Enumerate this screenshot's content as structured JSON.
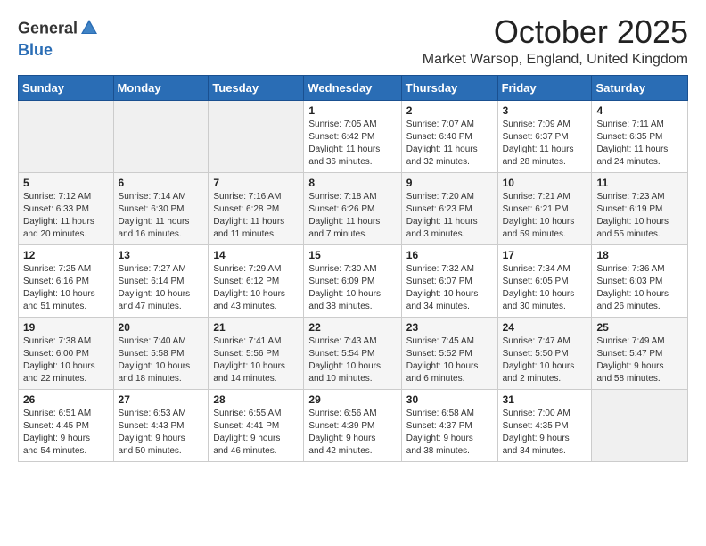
{
  "logo": {
    "general": "General",
    "blue": "Blue"
  },
  "title": "October 2025",
  "subtitle": "Market Warsop, England, United Kingdom",
  "days_of_week": [
    "Sunday",
    "Monday",
    "Tuesday",
    "Wednesday",
    "Thursday",
    "Friday",
    "Saturday"
  ],
  "weeks": [
    [
      {
        "day": "",
        "info": ""
      },
      {
        "day": "",
        "info": ""
      },
      {
        "day": "",
        "info": ""
      },
      {
        "day": "1",
        "info": "Sunrise: 7:05 AM\nSunset: 6:42 PM\nDaylight: 11 hours\nand 36 minutes."
      },
      {
        "day": "2",
        "info": "Sunrise: 7:07 AM\nSunset: 6:40 PM\nDaylight: 11 hours\nand 32 minutes."
      },
      {
        "day": "3",
        "info": "Sunrise: 7:09 AM\nSunset: 6:37 PM\nDaylight: 11 hours\nand 28 minutes."
      },
      {
        "day": "4",
        "info": "Sunrise: 7:11 AM\nSunset: 6:35 PM\nDaylight: 11 hours\nand 24 minutes."
      }
    ],
    [
      {
        "day": "5",
        "info": "Sunrise: 7:12 AM\nSunset: 6:33 PM\nDaylight: 11 hours\nand 20 minutes."
      },
      {
        "day": "6",
        "info": "Sunrise: 7:14 AM\nSunset: 6:30 PM\nDaylight: 11 hours\nand 16 minutes."
      },
      {
        "day": "7",
        "info": "Sunrise: 7:16 AM\nSunset: 6:28 PM\nDaylight: 11 hours\nand 11 minutes."
      },
      {
        "day": "8",
        "info": "Sunrise: 7:18 AM\nSunset: 6:26 PM\nDaylight: 11 hours\nand 7 minutes."
      },
      {
        "day": "9",
        "info": "Sunrise: 7:20 AM\nSunset: 6:23 PM\nDaylight: 11 hours\nand 3 minutes."
      },
      {
        "day": "10",
        "info": "Sunrise: 7:21 AM\nSunset: 6:21 PM\nDaylight: 10 hours\nand 59 minutes."
      },
      {
        "day": "11",
        "info": "Sunrise: 7:23 AM\nSunset: 6:19 PM\nDaylight: 10 hours\nand 55 minutes."
      }
    ],
    [
      {
        "day": "12",
        "info": "Sunrise: 7:25 AM\nSunset: 6:16 PM\nDaylight: 10 hours\nand 51 minutes."
      },
      {
        "day": "13",
        "info": "Sunrise: 7:27 AM\nSunset: 6:14 PM\nDaylight: 10 hours\nand 47 minutes."
      },
      {
        "day": "14",
        "info": "Sunrise: 7:29 AM\nSunset: 6:12 PM\nDaylight: 10 hours\nand 43 minutes."
      },
      {
        "day": "15",
        "info": "Sunrise: 7:30 AM\nSunset: 6:09 PM\nDaylight: 10 hours\nand 38 minutes."
      },
      {
        "day": "16",
        "info": "Sunrise: 7:32 AM\nSunset: 6:07 PM\nDaylight: 10 hours\nand 34 minutes."
      },
      {
        "day": "17",
        "info": "Sunrise: 7:34 AM\nSunset: 6:05 PM\nDaylight: 10 hours\nand 30 minutes."
      },
      {
        "day": "18",
        "info": "Sunrise: 7:36 AM\nSunset: 6:03 PM\nDaylight: 10 hours\nand 26 minutes."
      }
    ],
    [
      {
        "day": "19",
        "info": "Sunrise: 7:38 AM\nSunset: 6:00 PM\nDaylight: 10 hours\nand 22 minutes."
      },
      {
        "day": "20",
        "info": "Sunrise: 7:40 AM\nSunset: 5:58 PM\nDaylight: 10 hours\nand 18 minutes."
      },
      {
        "day": "21",
        "info": "Sunrise: 7:41 AM\nSunset: 5:56 PM\nDaylight: 10 hours\nand 14 minutes."
      },
      {
        "day": "22",
        "info": "Sunrise: 7:43 AM\nSunset: 5:54 PM\nDaylight: 10 hours\nand 10 minutes."
      },
      {
        "day": "23",
        "info": "Sunrise: 7:45 AM\nSunset: 5:52 PM\nDaylight: 10 hours\nand 6 minutes."
      },
      {
        "day": "24",
        "info": "Sunrise: 7:47 AM\nSunset: 5:50 PM\nDaylight: 10 hours\nand 2 minutes."
      },
      {
        "day": "25",
        "info": "Sunrise: 7:49 AM\nSunset: 5:47 PM\nDaylight: 9 hours\nand 58 minutes."
      }
    ],
    [
      {
        "day": "26",
        "info": "Sunrise: 6:51 AM\nSunset: 4:45 PM\nDaylight: 9 hours\nand 54 minutes."
      },
      {
        "day": "27",
        "info": "Sunrise: 6:53 AM\nSunset: 4:43 PM\nDaylight: 9 hours\nand 50 minutes."
      },
      {
        "day": "28",
        "info": "Sunrise: 6:55 AM\nSunset: 4:41 PM\nDaylight: 9 hours\nand 46 minutes."
      },
      {
        "day": "29",
        "info": "Sunrise: 6:56 AM\nSunset: 4:39 PM\nDaylight: 9 hours\nand 42 minutes."
      },
      {
        "day": "30",
        "info": "Sunrise: 6:58 AM\nSunset: 4:37 PM\nDaylight: 9 hours\nand 38 minutes."
      },
      {
        "day": "31",
        "info": "Sunrise: 7:00 AM\nSunset: 4:35 PM\nDaylight: 9 hours\nand 34 minutes."
      },
      {
        "day": "",
        "info": ""
      }
    ]
  ]
}
